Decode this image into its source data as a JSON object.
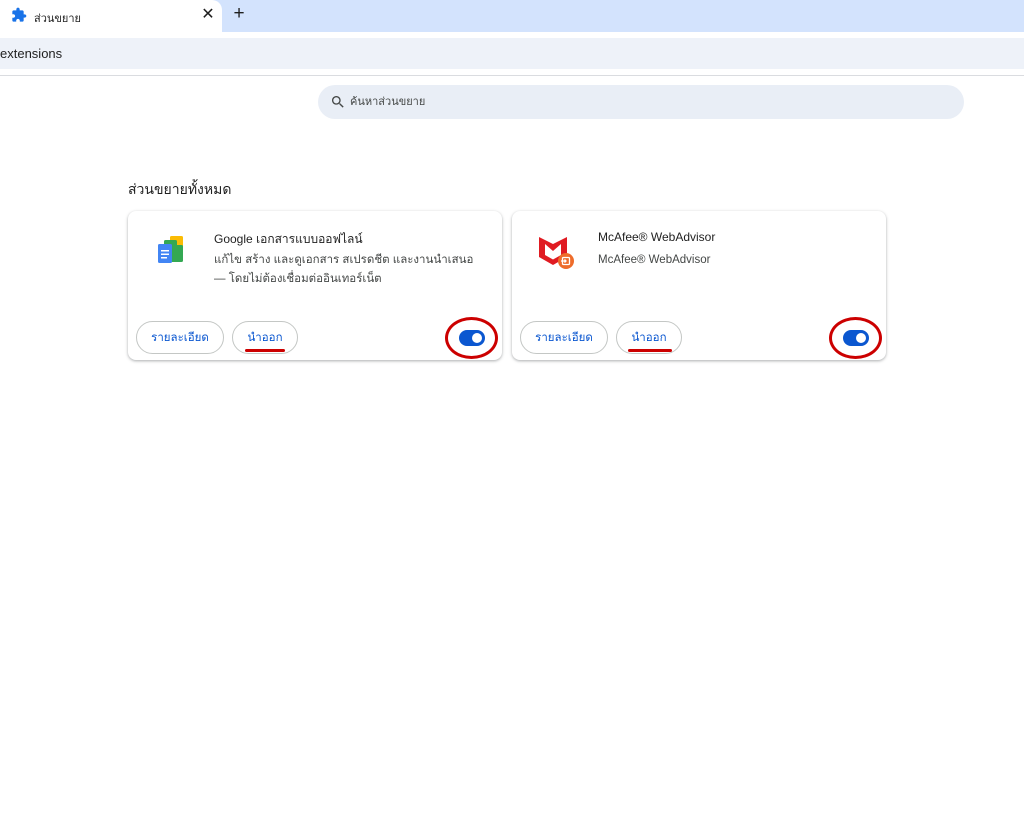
{
  "tab": {
    "title": "ส่วนขยาย",
    "close_label": "✕",
    "new_tab_label": "+"
  },
  "address_bar": {
    "text": "extensions"
  },
  "search": {
    "placeholder": "ค้นหาส่วนขยาย"
  },
  "section_title": "ส่วนขยายทั้งหมด",
  "extensions": [
    {
      "name": "Google เอกสารแบบออฟไลน์",
      "description": "แก้ไข สร้าง และดูเอกสาร สเปรดชีต และงานนำเสนอ — โดยไม่ต้องเชื่อมต่ออินเทอร์เน็ต",
      "details_label": "รายละเอียด",
      "remove_label": "นำออก",
      "enabled": true,
      "icon": "google-docs-offline-icon"
    },
    {
      "name": "McAfee® WebAdvisor",
      "description": "McAfee® WebAdvisor",
      "details_label": "รายละเอียด",
      "remove_label": "นำออก",
      "enabled": true,
      "icon": "mcafee-icon"
    }
  ],
  "colors": {
    "accent": "#0b57d0",
    "annotation": "#cc0000",
    "tabstrip": "#d3e3fd"
  }
}
